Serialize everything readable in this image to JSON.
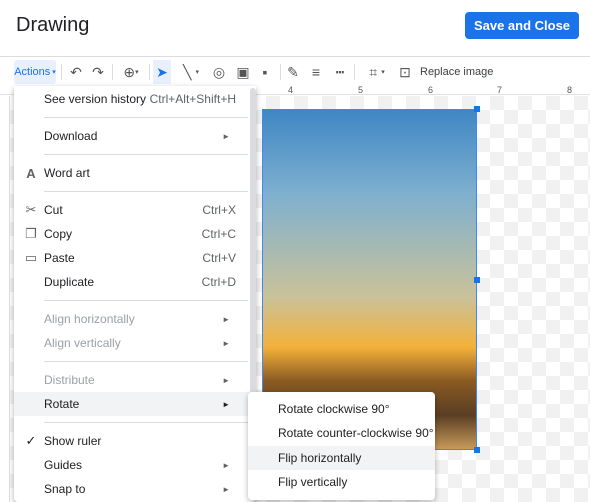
{
  "header": {
    "title": "Drawing",
    "save_label": "Save and Close"
  },
  "toolbar": {
    "actions_label": "Actions",
    "replace_image_label": "Replace image"
  },
  "ruler": {
    "labels": [
      "4",
      "5",
      "6",
      "7",
      "8"
    ]
  },
  "menu": {
    "items": [
      {
        "label": "See version history",
        "shortcut": "Ctrl+Alt+Shift+H"
      },
      {
        "label": "Download"
      },
      {
        "label": "Word art",
        "icon": "word-art-icon"
      },
      {
        "label": "Cut",
        "shortcut": "Ctrl+X",
        "icon": "scissors-icon"
      },
      {
        "label": "Copy",
        "shortcut": "Ctrl+C",
        "icon": "copy-icon"
      },
      {
        "label": "Paste",
        "shortcut": "Ctrl+V",
        "icon": "clipboard-icon"
      },
      {
        "label": "Duplicate",
        "shortcut": "Ctrl+D"
      },
      {
        "label": "Align horizontally",
        "disabled": true
      },
      {
        "label": "Align vertically",
        "disabled": true
      },
      {
        "label": "Distribute",
        "disabled": true
      },
      {
        "label": "Rotate",
        "highlighted": true
      },
      {
        "label": "Show ruler",
        "checked": true
      },
      {
        "label": "Guides"
      },
      {
        "label": "Snap to"
      }
    ]
  },
  "submenu": {
    "items": [
      {
        "label": "Rotate clockwise 90°"
      },
      {
        "label": "Rotate counter-clockwise 90°"
      },
      {
        "label": "Flip horizontally",
        "highlighted": true
      },
      {
        "label": "Flip vertically"
      }
    ]
  },
  "colors": {
    "accent": "#1a73e8",
    "selection": "#4285f4"
  }
}
